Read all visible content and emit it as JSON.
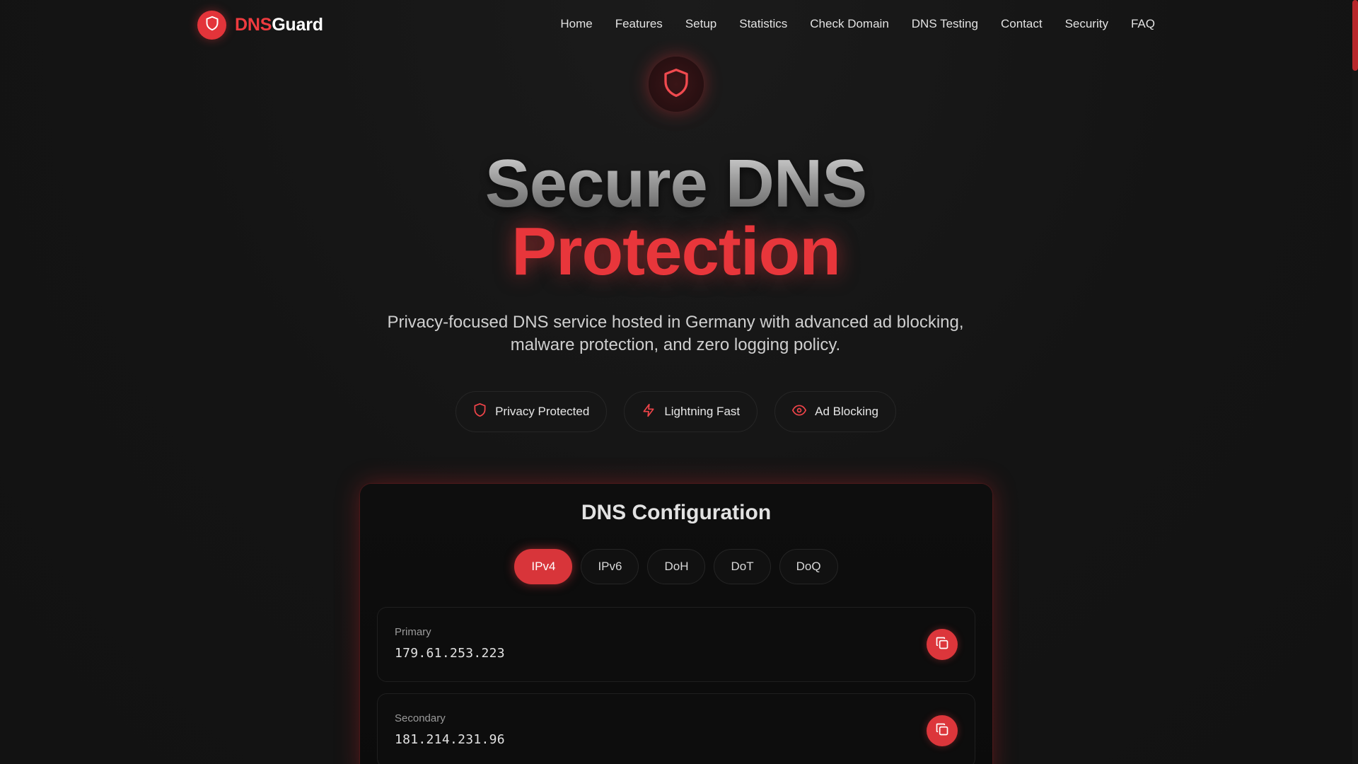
{
  "brand": {
    "name_part1": "DNS",
    "name_part2": "Guard",
    "logo_icon": "shield-icon"
  },
  "nav": {
    "items": [
      "Home",
      "Features",
      "Setup",
      "Statistics",
      "Check Domain",
      "DNS Testing",
      "Contact",
      "Security",
      "FAQ"
    ]
  },
  "hero": {
    "icon": "shield-icon",
    "title_line1": "Secure DNS",
    "title_line2": "Protection",
    "subtitle": "Privacy-focused DNS service hosted in Germany with advanced ad blocking, malware protection, and zero logging policy."
  },
  "badges": [
    {
      "label": "Privacy Protected",
      "icon": "shield-icon"
    },
    {
      "label": "Lightning Fast",
      "icon": "lightning-icon"
    },
    {
      "label": "Ad Blocking",
      "icon": "eye-icon"
    }
  ],
  "config": {
    "title": "DNS Configuration",
    "tabs": [
      "IPv4",
      "IPv6",
      "DoH",
      "DoT",
      "DoQ"
    ],
    "active_tab": "IPv4",
    "addresses": [
      {
        "label": "Primary",
        "value": "179.61.253.223"
      },
      {
        "label": "Secondary",
        "value": "181.214.231.96"
      }
    ]
  },
  "colors": {
    "accent": "#e3343a",
    "background": "#141414",
    "card": "#0e0e0e"
  }
}
